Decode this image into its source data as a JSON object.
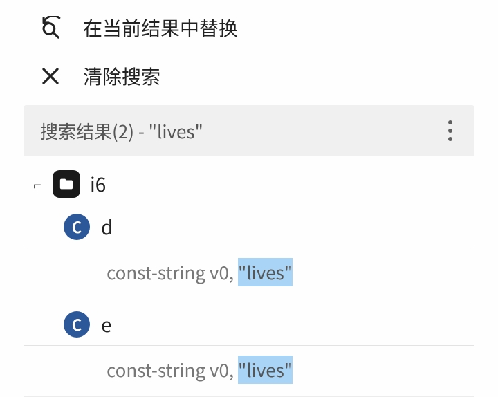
{
  "actions": {
    "replaceInResults": "在当前结果中替换",
    "clearSearch": "清除搜索"
  },
  "resultsHeader": {
    "label": "搜索结果(2) - \"lives\"",
    "count": 2,
    "query": "lives"
  },
  "tree": {
    "folder": {
      "collapseGlyph": "⌐",
      "name": "i6",
      "children": [
        {
          "chipLetter": "C",
          "name": "d",
          "match": {
            "prefix": "const-string v0, ",
            "highlight": "\"lives\""
          }
        },
        {
          "chipLetter": "C",
          "name": "e",
          "match": {
            "prefix": "const-string v0, ",
            "highlight": "\"lives\""
          }
        }
      ]
    }
  },
  "colors": {
    "fileChip": "#2c5899",
    "highlight": "#a9d4f5",
    "barBg": "#f1f0f1"
  }
}
